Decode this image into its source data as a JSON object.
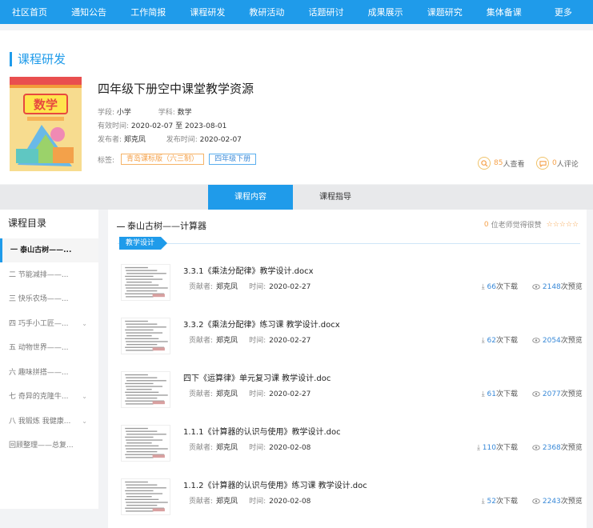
{
  "nav": [
    "社区首页",
    "通知公告",
    "工作简报",
    "课程研发",
    "教研活动",
    "话题研讨",
    "成果展示",
    "课题研究",
    "集体备课",
    "更多"
  ],
  "section_title": "课程研发",
  "course": {
    "title": "四年级下册空中课堂教学资源",
    "cover_text": "数学",
    "stage_label": "学段:",
    "stage": "小学",
    "subject_label": "学科:",
    "subject": "数学",
    "valid_label": "有效时间:",
    "valid_from": "2020-02-07",
    "valid_to_word": "至",
    "valid_to": "2023-08-01",
    "publisher_label": "发布者:",
    "publisher": "郑克凤",
    "pubtime_label": "发布时间:",
    "pubtime": "2020-02-07",
    "tags_label": "标签:",
    "tags": [
      "青岛课标版（六三制）",
      "四年级下册"
    ],
    "views": "85",
    "views_suffix": "人查看",
    "comments": "0",
    "comments_suffix": "人评论"
  },
  "tabs": [
    "课程内容",
    "课程指导"
  ],
  "sidebar": {
    "title": "课程目录",
    "items": [
      {
        "label": "一 泰山古树——...",
        "chevron": false
      },
      {
        "label": "二 节能减排——...",
        "chevron": false
      },
      {
        "label": "三 快乐农场——...",
        "chevron": false
      },
      {
        "label": "四 巧手小工匠—...",
        "chevron": true
      },
      {
        "label": "五 动物世界——...",
        "chevron": false
      },
      {
        "label": "六 趣味拼搭——...",
        "chevron": false
      },
      {
        "label": "七 奇异的克隆牛...",
        "chevron": true
      },
      {
        "label": "八 我锻炼 我健康...",
        "chevron": true
      },
      {
        "label": "回顾整理——总复...",
        "chevron": false
      }
    ]
  },
  "main": {
    "unit_title": "泰山古树——计算器",
    "fav_count": "0",
    "fav_text": "位老师觉得很赞",
    "stars": "☆☆☆☆☆",
    "badge": "教学设计",
    "contributor_label": "贡献者:",
    "time_label": "时间:",
    "download_suffix": "次下载",
    "preview_suffix": "次预览",
    "resources": [
      {
        "title": "3.3.1《乘法分配律》教学设计.docx",
        "contributor": "郑克凤",
        "time": "2020-02-27",
        "downloads": "66",
        "previews": "2148"
      },
      {
        "title": "3.3.2《乘法分配律》练习课 教学设计.docx",
        "contributor": "郑克凤",
        "time": "2020-02-27",
        "downloads": "62",
        "previews": "2054"
      },
      {
        "title": "四下《运算律》单元复习课 教学设计.doc",
        "contributor": "郑克凤",
        "time": "2020-02-27",
        "downloads": "61",
        "previews": "2077"
      },
      {
        "title": "1.1.1《计算器的认识与使用》教学设计.doc",
        "contributor": "郑克凤",
        "time": "2020-02-08",
        "downloads": "110",
        "previews": "2368"
      },
      {
        "title": "1.1.2《计算器的认识与使用》练习课 教学设计.doc",
        "contributor": "郑克凤",
        "time": "2020-02-08",
        "downloads": "52",
        "previews": "2243"
      }
    ]
  },
  "icons": {
    "search": "search-icon",
    "comment": "comment-icon",
    "download": "download-icon",
    "eye": "eye-icon"
  },
  "colors": {
    "accent": "#1f9bea",
    "orange": "#f5a24b",
    "link": "#3a8ad8"
  }
}
